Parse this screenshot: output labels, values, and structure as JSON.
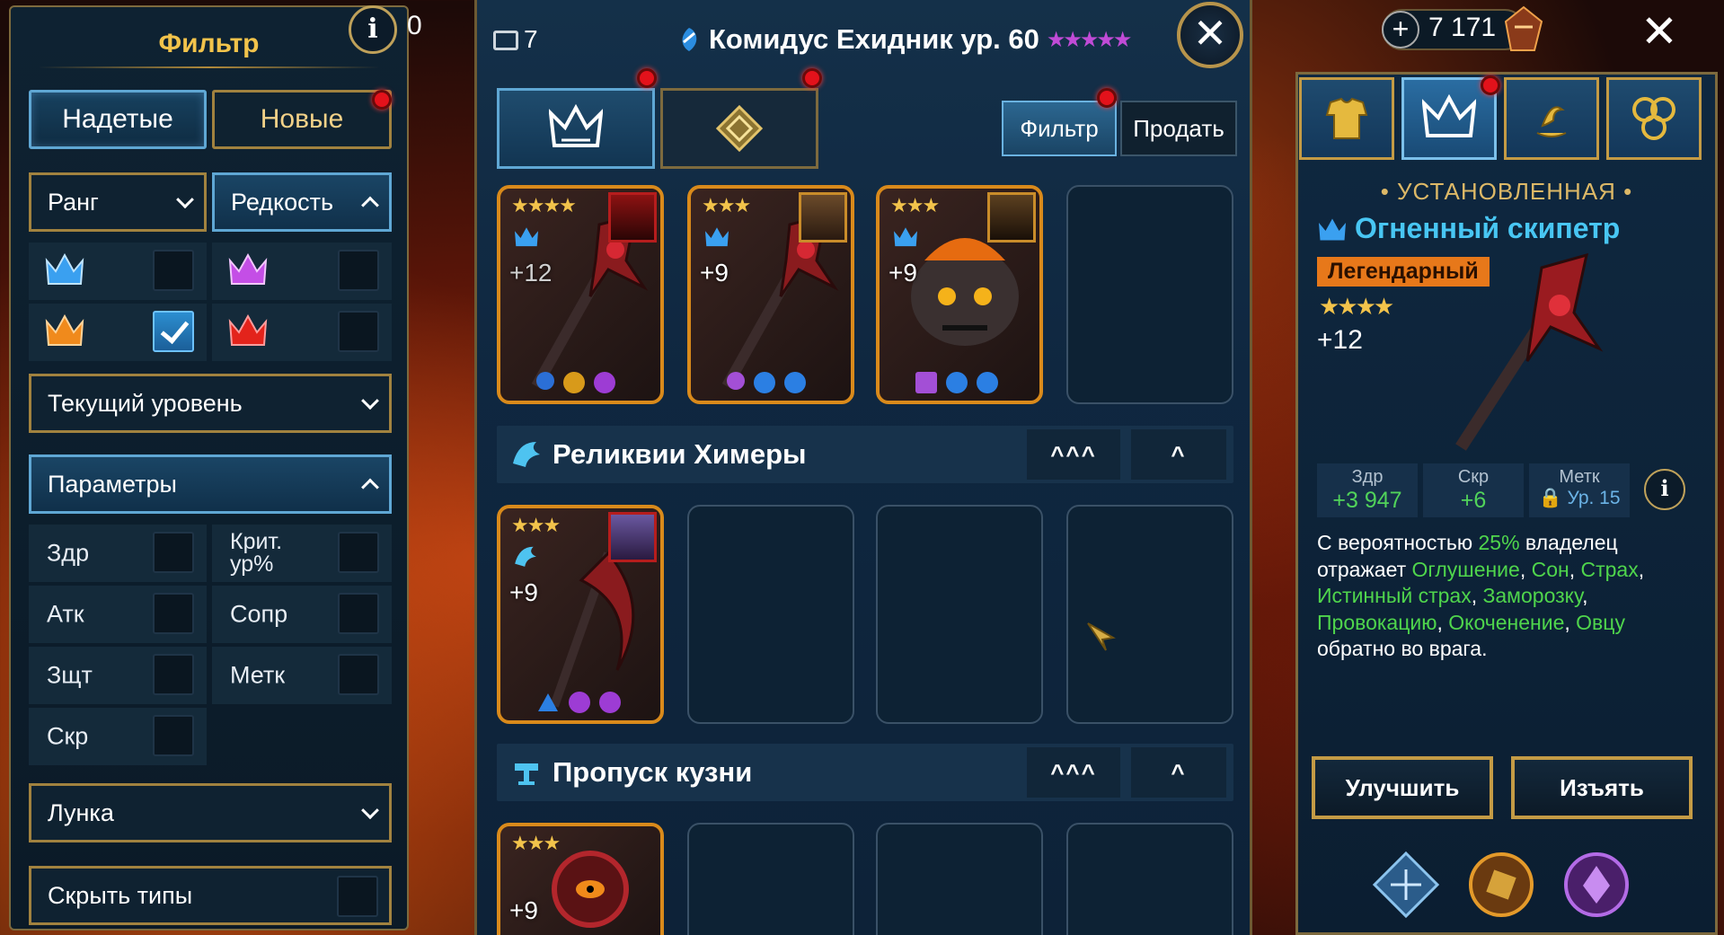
{
  "filter_panel": {
    "title": "Фильтр",
    "stray_digit": "0",
    "tabs": [
      {
        "label": "Надетые",
        "active": true
      },
      {
        "label": "Новые",
        "active": false,
        "notification": true
      }
    ],
    "rank_dropdown": "Ранг",
    "rarity_dropdown": "Редкость",
    "rarity_options": [
      {
        "icon": "blue-crown-icon",
        "color": "#3aa0f0",
        "checked": false
      },
      {
        "icon": "purple-crown-icon",
        "color": "#c44ee6",
        "checked": false
      },
      {
        "icon": "orange-crown-icon",
        "color": "#f08a1c",
        "checked": true
      },
      {
        "icon": "red-crown-icon",
        "color": "#e3231b",
        "checked": false
      }
    ],
    "current_level_dropdown": "Текущий уровень",
    "parameters_dropdown": "Параметры",
    "parameters": [
      {
        "label": "Здр",
        "checked": false
      },
      {
        "label": "Крит. ур%",
        "checked": false
      },
      {
        "label": "Атк",
        "checked": false
      },
      {
        "label": "Сопр",
        "checked": false
      },
      {
        "label": "Зщт",
        "checked": false
      },
      {
        "label": "Метк",
        "checked": false
      },
      {
        "label": "Скр",
        "checked": false
      }
    ],
    "socket_dropdown": "Лунка",
    "hide_types": "Скрыть типы"
  },
  "inventory": {
    "bag_count": "7",
    "hero_title": "Комидус Ехидник ур. 60",
    "hero_stars": "★★★★★",
    "filter_button": "Фильтр",
    "sell_button": "Продать",
    "close": "✕",
    "rows": [
      {
        "items": [
          {
            "stars": "★★★★",
            "level": "+12",
            "weapon": "scepter"
          },
          {
            "stars": "★★★",
            "level": "+9",
            "weapon": "scepter"
          },
          {
            "stars": "★★★",
            "level": "+9",
            "weapon": "skull"
          }
        ]
      }
    ],
    "sets": [
      {
        "title": "Реликвии Химеры",
        "sort_many": "^^^",
        "sort_one": "^",
        "items": [
          {
            "stars": "★★★",
            "level": "+9",
            "weapon": "scythe"
          }
        ]
      },
      {
        "title": "Пропуск кузни",
        "sort_many": "^^^",
        "sort_one": "^",
        "items": [
          {
            "stars": "★★★",
            "level": "+9",
            "weapon": "eye"
          }
        ]
      }
    ]
  },
  "detail": {
    "currency": "7 171",
    "close": "✕",
    "installed": "• УСТАНОВЛЕННАЯ •",
    "name": "Огненный скипетр",
    "rarity": "Легендарный",
    "stars": "★★★★",
    "level": "+12",
    "stats": [
      {
        "label": "Здр",
        "value": "+3 947"
      },
      {
        "label": "Скр",
        "value": "+6"
      },
      {
        "label": "Метк",
        "value": "Ур. 15",
        "locked": true
      }
    ],
    "description": {
      "p1": "С вероятностью ",
      "chance": "25%",
      "p2": " владелец отражает ",
      "e1": "Оглушение",
      "e2": "Сон",
      "e3": "Страх",
      "e4": "Истинный страх",
      "e5": "Заморозку",
      "e6": "Провокацию",
      "e7": "Окоченение",
      "e8": "Овцу",
      "p3": " обратно во врага.",
      "comma": ", "
    },
    "upgrade_button": "Улучшить",
    "remove_button": "Изъять"
  }
}
